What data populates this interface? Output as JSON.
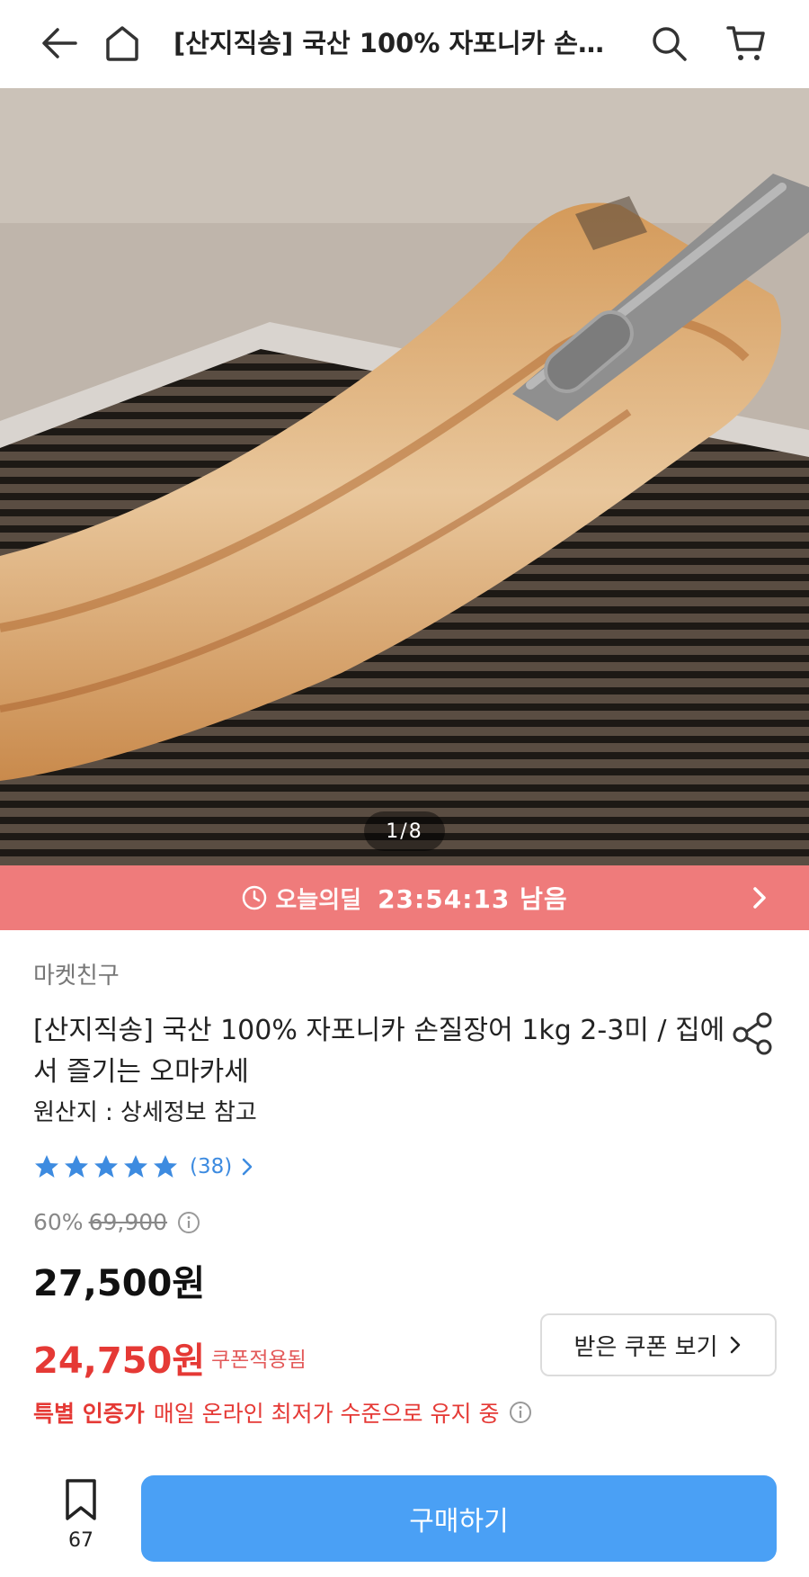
{
  "header": {
    "title": "[산지직송] 국산 100% 자포니카 손…",
    "icons": [
      "back-icon",
      "home-icon",
      "search-icon",
      "cart-icon"
    ]
  },
  "hero": {
    "pager": "1/8",
    "image_desc_icon": "grilled-eel-photo"
  },
  "deal": {
    "label": "오늘의딜",
    "timer": "23:54:13 남음",
    "color": "#ef7b7b"
  },
  "product": {
    "seller": "마켓친구",
    "title": "[산지직송] 국산 100% 자포니카 손질장어 1kg 2-3미 / 집에서 즐기는 오마카세",
    "origin": "원산지 : 상세정보 참고",
    "rating_stars": 5,
    "review_count": "(38)",
    "discount_pct": "60%",
    "original_price": "69,900",
    "price": "27,500원",
    "coupon_price": "24,750원",
    "coupon_applied": "쿠폰적용됨",
    "coupon_button": "받은 쿠폰 보기",
    "special_label": "특별 인증가",
    "special_text": "매일 온라인 최저가 수준으로 유지 중"
  },
  "bottom": {
    "bookmark_count": "67",
    "buy_label": "구매하기",
    "accent": "#4aa0f5"
  }
}
